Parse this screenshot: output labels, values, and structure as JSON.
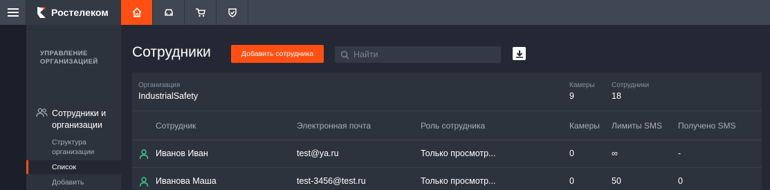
{
  "header": {
    "logo_text": "Ростелеком",
    "tabs": [
      {
        "name": "home",
        "icon": "home-icon",
        "active": true
      },
      {
        "name": "car",
        "icon": "car-icon",
        "active": false
      },
      {
        "name": "cart",
        "icon": "cart-icon",
        "active": false
      },
      {
        "name": "shield",
        "icon": "shield-icon",
        "active": false
      }
    ]
  },
  "sidebar": {
    "section_title": "УПРАВЛЕНИЕ ОРГАНИЗАЦИЕЙ",
    "main_item": "Сотрудники и организации",
    "sub_items": [
      "Структура организации",
      "Список",
      "Добавить"
    ],
    "active_sub": "Список"
  },
  "main": {
    "title": "Сотрудники",
    "add_button": "Добавить сотрудника",
    "search_placeholder": "Найти"
  },
  "org": {
    "org_label": "Организация",
    "org_name": "IndustrialSafety",
    "cameras_label": "Камеры",
    "cameras_value": "9",
    "employees_label": "Сотрудники",
    "employees_value": "18"
  },
  "table": {
    "columns": [
      "Сотрудник",
      "Электронная почта",
      "Роль сотрудника",
      "Камеры",
      "Лимиты SMS",
      "Получено SMS"
    ],
    "rows": [
      {
        "name": "Иванов Иван",
        "email": "test@ya.ru",
        "role": "Только просмотр...",
        "cameras": "0",
        "sms_limit": "∞",
        "sms_received": "-"
      },
      {
        "name": "Иванова Маша",
        "email": "test-3456@test.ru",
        "role": "Только просмотр...",
        "cameras": "0",
        "sms_limit": "50",
        "sms_received": "0"
      }
    ]
  },
  "colors": {
    "accent": "#ff4f12",
    "background": "#232834",
    "panel": "#2d333d",
    "user_icon": "#3ccf8e"
  }
}
